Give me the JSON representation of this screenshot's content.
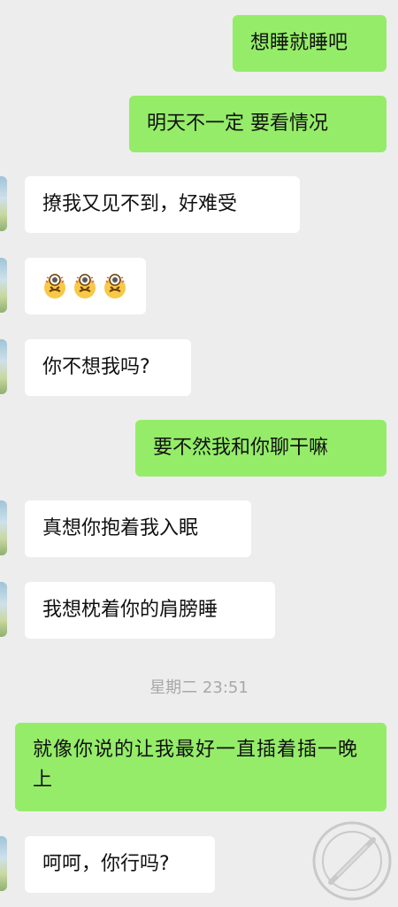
{
  "messages": [
    {
      "id": 1,
      "direction": "outgoing",
      "text": "想睡就睡吧"
    },
    {
      "id": 2,
      "direction": "outgoing",
      "text": "明天不一定 要看情况"
    },
    {
      "id": 3,
      "direction": "incoming",
      "text": "撩我又见不到，好难受"
    },
    {
      "id": 4,
      "direction": "incoming",
      "text": "",
      "emoji": [
        "facepalm-emoji",
        "facepalm-emoji",
        "facepalm-emoji"
      ]
    },
    {
      "id": 5,
      "direction": "incoming",
      "text": "你不想我吗?"
    },
    {
      "id": 6,
      "direction": "outgoing",
      "text": "要不然我和你聊干嘛"
    },
    {
      "id": 7,
      "direction": "incoming",
      "text": "真想你抱着我入眠"
    },
    {
      "id": 8,
      "direction": "incoming",
      "text": "我想枕着你的肩膀睡"
    },
    {
      "id": 9,
      "direction": "outgoing",
      "text": "就像你说的让我最好一直插着插一晚上"
    },
    {
      "id": 10,
      "direction": "incoming",
      "text": "呵呵，你行吗?"
    }
  ],
  "timestamp": "星期二 23:51",
  "colors": {
    "background": "#ededed",
    "outgoing_bubble": "#95ec69",
    "incoming_bubble": "#ffffff",
    "timestamp_text": "#a8a8a8"
  }
}
